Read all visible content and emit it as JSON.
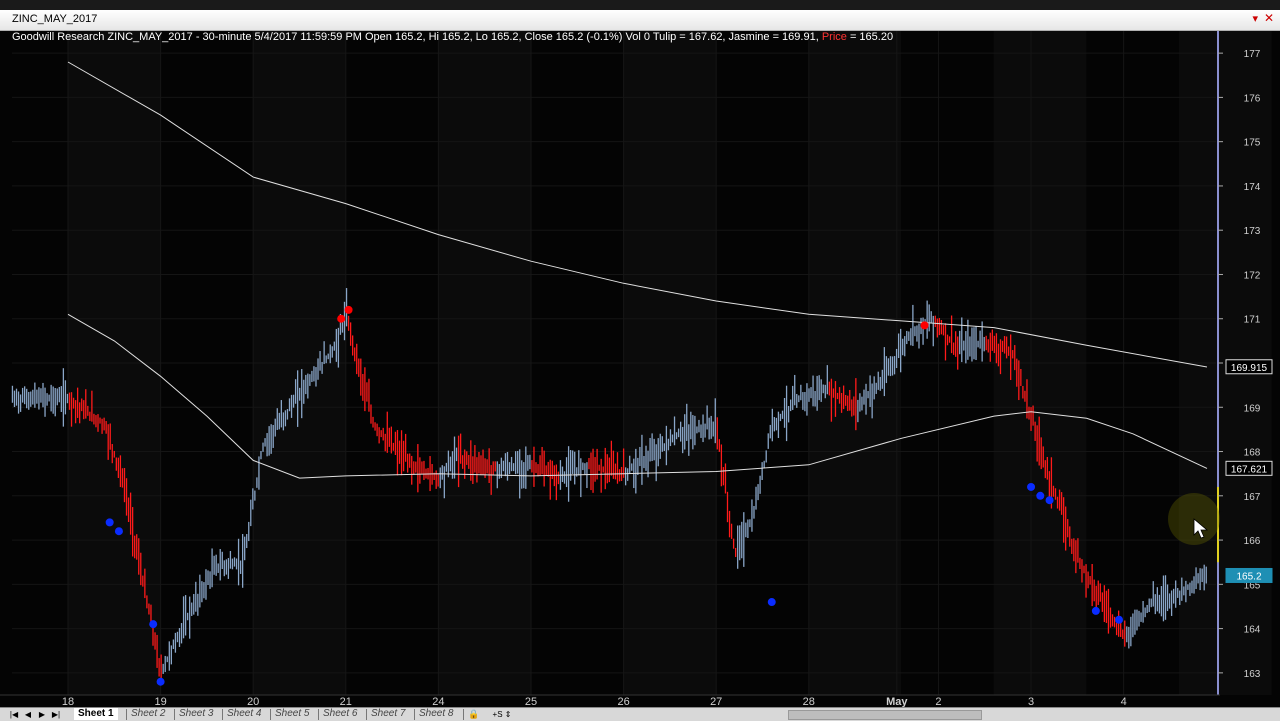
{
  "window": {
    "title": "ZINC_MAY_2017",
    "pin_icon": "pin-icon",
    "close_label": "✕"
  },
  "info": {
    "text": "Goodwill Research ZINC_MAY_2017 - 30-minute 5/4/2017 11:59:59 PM Open 165.2, Hi 165.2, Lo 165.2, Close 165.2 (-0.1%) Vol 0 Tulip = 167.62, Jasmine = 169.91,",
    "price_label": "Price",
    "price_value": "= 165.20"
  },
  "colors": {
    "background": "#040404",
    "bar_down": "#ff1a1a",
    "bar_up": "#8aa6c8",
    "ma_line": "#e0e0e0",
    "marker": "#0a2cff",
    "price_label_bg": "#1e8fb4"
  },
  "chart_data": {
    "type": "line",
    "symbol": "ZINC_MAY_2017",
    "ylim": [
      162.5,
      177.5
    ],
    "y_ticks": [
      "163",
      "164",
      "165",
      "166",
      "167",
      "168",
      "169",
      "170",
      "171",
      "172",
      "173",
      "174",
      "175",
      "176",
      "177"
    ],
    "x_labels": [
      "18",
      "19",
      "20",
      "21",
      "24",
      "25",
      "26",
      "27",
      "28",
      "May",
      "2",
      "3",
      "4"
    ],
    "x_label_day_index": [
      0,
      1,
      2,
      3,
      4,
      5,
      6,
      7,
      8,
      8.95,
      9.4,
      10.4,
      11.4
    ],
    "series": [
      {
        "name": "Jasmine",
        "day_x": [
          0,
          1,
          2,
          3,
          4,
          5,
          6,
          7,
          8,
          9,
          10,
          11,
          12.3
        ],
        "values": [
          176.8,
          175.6,
          174.2,
          173.6,
          172.9,
          172.3,
          171.8,
          171.4,
          171.1,
          170.95,
          170.8,
          170.4,
          169.91
        ]
      },
      {
        "name": "Tulip",
        "day_x": [
          0,
          0.5,
          1,
          1.5,
          2,
          2.5,
          3,
          4,
          5,
          6,
          7,
          8,
          9,
          10,
          10.4,
          11,
          11.5,
          12.3
        ],
        "values": [
          171.1,
          170.5,
          169.7,
          168.8,
          167.8,
          167.4,
          167.45,
          167.5,
          167.45,
          167.5,
          167.55,
          167.7,
          168.3,
          168.8,
          168.9,
          168.75,
          168.4,
          167.62
        ]
      },
      {
        "name": "Price",
        "day_x": [
          0,
          0.4,
          0.6,
          0.9,
          1.0,
          1.3,
          1.6,
          1.9,
          2.1,
          2.5,
          2.9,
          3.0,
          3.3,
          3.7,
          4.0,
          4.2,
          4.6,
          5.0,
          5.3,
          5.6,
          6.0,
          6.3,
          6.6,
          7.0,
          7.2,
          7.4,
          7.6,
          7.9,
          8.2,
          8.5,
          8.8,
          9.1,
          9.35,
          9.6,
          9.9,
          10.2,
          10.4,
          10.6,
          10.9,
          11.1,
          11.4,
          11.7,
          12.0,
          12.3
        ],
        "values": [
          169.2,
          168.6,
          167.3,
          164.1,
          163.0,
          164.3,
          165.4,
          165.5,
          168.1,
          169.3,
          170.4,
          171.1,
          168.6,
          167.7,
          167.4,
          167.9,
          167.6,
          167.7,
          167.4,
          167.7,
          167.5,
          167.9,
          168.4,
          168.6,
          165.7,
          166.5,
          168.6,
          169.2,
          169.4,
          169.0,
          169.6,
          170.7,
          171.0,
          170.3,
          170.5,
          170.2,
          168.8,
          167.4,
          165.6,
          164.9,
          163.8,
          164.6,
          164.8,
          165.2
        ]
      }
    ],
    "signals_down": [
      {
        "day_x": 0.45,
        "value": 166.4
      },
      {
        "day_x": 0.55,
        "value": 166.2
      },
      {
        "day_x": 0.92,
        "value": 164.1
      },
      {
        "day_x": 1.0,
        "value": 162.8
      },
      {
        "day_x": 7.6,
        "value": 164.6
      },
      {
        "day_x": 10.4,
        "value": 167.2
      },
      {
        "day_x": 10.5,
        "value": 167.0
      },
      {
        "day_x": 10.6,
        "value": 166.9
      },
      {
        "day_x": 11.1,
        "value": 164.4
      },
      {
        "day_x": 11.35,
        "value": 164.2
      }
    ],
    "signals_up": [
      {
        "day_x": 2.95,
        "value": 171.0
      },
      {
        "day_x": 3.03,
        "value": 171.2
      },
      {
        "day_x": 9.25,
        "value": 170.85
      }
    ],
    "price_labels": [
      {
        "text": "169.915",
        "value": 169.915,
        "style": "outline"
      },
      {
        "text": "167.621",
        "value": 167.621,
        "style": "outline"
      },
      {
        "text": "165.2",
        "value": 165.2,
        "style": "filled"
      }
    ],
    "grid": true,
    "vertical_day_separators": true
  },
  "sheets": {
    "nav_icons": [
      "first-sheet-icon",
      "prev-sheet-icon",
      "next-sheet-icon",
      "last-sheet-icon"
    ],
    "nav_glyphs": [
      "|◀",
      "◀",
      "▶",
      "▶|"
    ],
    "tabs": [
      "Sheet 1",
      "Sheet 2",
      "Sheet 3",
      "Sheet 4",
      "Sheet 5",
      "Sheet 6",
      "Sheet 7",
      "Sheet 8"
    ],
    "active": 0,
    "lock_icon": "lock-icon",
    "lock_glyph": "🔒",
    "tools_glyph": "+S ⇕"
  }
}
